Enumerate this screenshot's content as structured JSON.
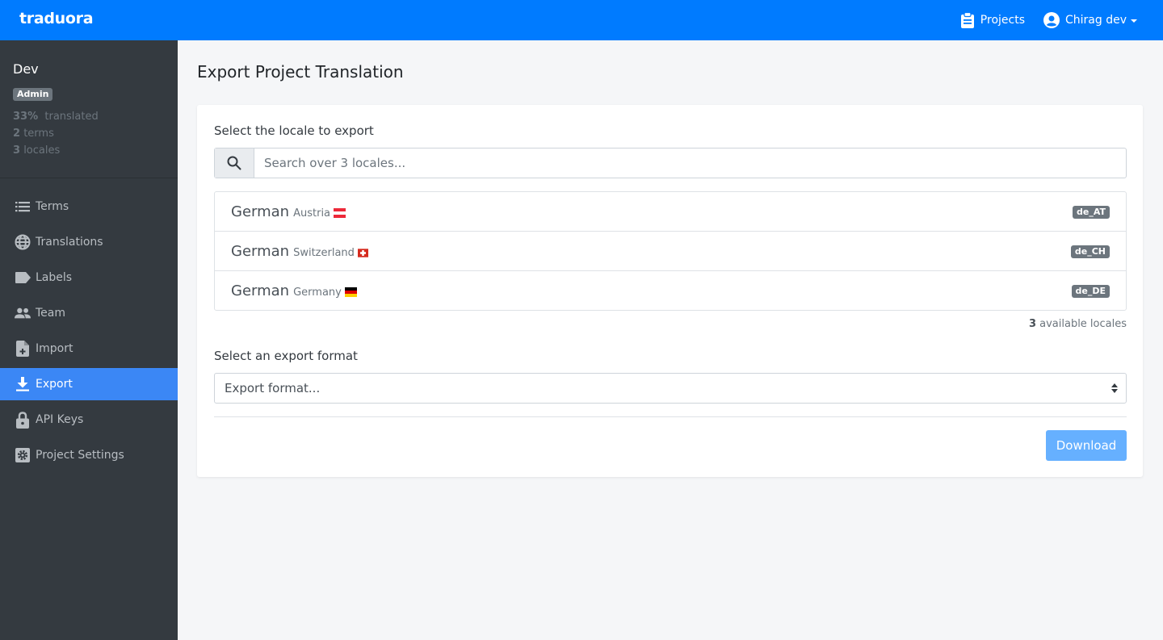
{
  "navbar": {
    "brand": "traduora",
    "projects_label": "Projects",
    "user_label": "Chirag dev",
    "color": "#007bff"
  },
  "sidebar": {
    "project_name": "Dev",
    "role_badge": "Admin",
    "stats": {
      "translated_value": "33%",
      "translated_label": "translated",
      "terms_value": "2",
      "terms_label": "terms",
      "locales_value": "3",
      "locales_label": "locales"
    },
    "items": [
      {
        "label": "Terms",
        "icon": "list-icon",
        "active": false
      },
      {
        "label": "Translations",
        "icon": "globe-icon",
        "active": false
      },
      {
        "label": "Labels",
        "icon": "label-icon",
        "active": false
      },
      {
        "label": "Team",
        "icon": "people-icon",
        "active": false
      },
      {
        "label": "Import",
        "icon": "file-plus-icon",
        "active": false
      },
      {
        "label": "Export",
        "icon": "download-icon",
        "active": true
      },
      {
        "label": "API Keys",
        "icon": "lock-icon",
        "active": false
      },
      {
        "label": "Project Settings",
        "icon": "gear-icon",
        "active": false
      }
    ]
  },
  "main": {
    "title": "Export Project Translation",
    "locale_section_label": "Select the locale to export",
    "search": {
      "placeholder": "Search over 3 locales...",
      "value": ""
    },
    "locales": [
      {
        "language": "German",
        "region": "Austria",
        "code": "de_AT",
        "flag": "austria-flag"
      },
      {
        "language": "German",
        "region": "Switzerland",
        "code": "de_CH",
        "flag": "switzerland-flag"
      },
      {
        "language": "German",
        "region": "Germany",
        "code": "de_DE",
        "flag": "germany-flag"
      }
    ],
    "available_count": "3",
    "available_label": "available locales",
    "format_section_label": "Select an export format",
    "format_select": {
      "selected": "Export format..."
    },
    "download_label": "Download"
  }
}
